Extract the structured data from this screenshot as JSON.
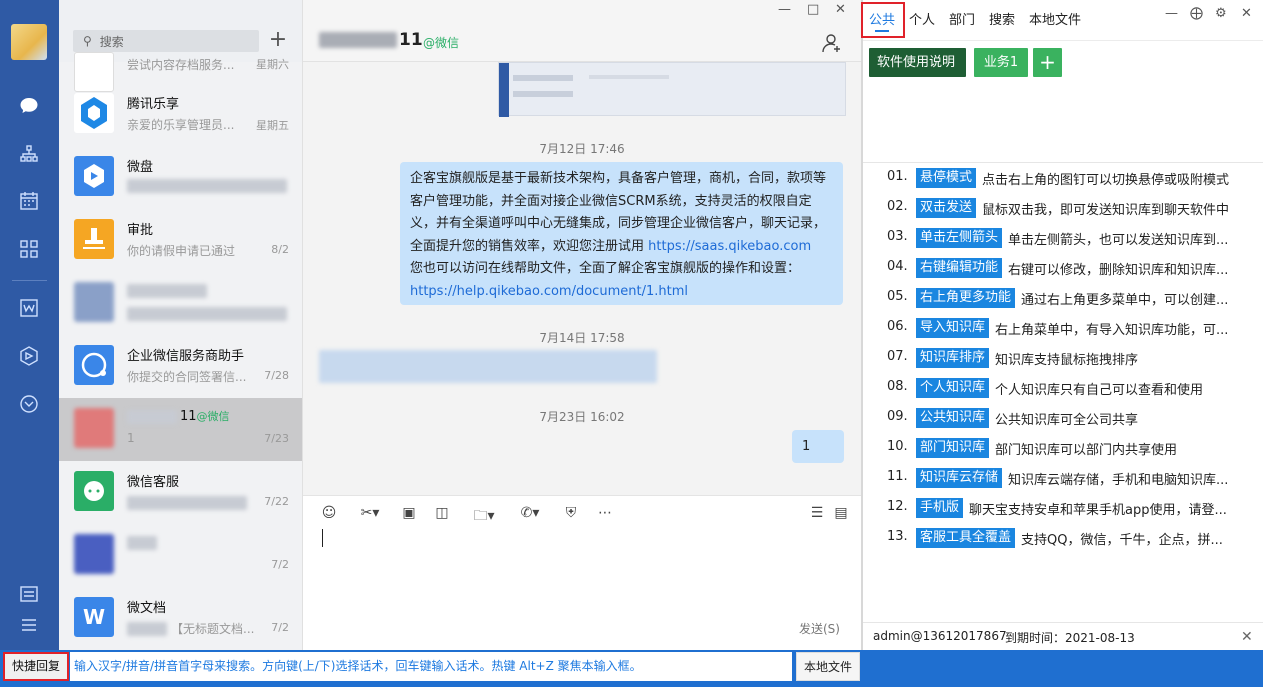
{
  "search": {
    "placeholder": "搜索"
  },
  "conversations": [
    {
      "name": "",
      "snippet": "尝试内容存档服务...",
      "date": "星期六",
      "color": "#f5a623"
    },
    {
      "name": "腾讯乐享",
      "snippet": "亲爱的乐享管理员...",
      "date": "星期五",
      "color": "#1e88e5"
    },
    {
      "name": "微盘",
      "snippet": "",
      "date": "",
      "color": "#3a86e8"
    },
    {
      "name": "审批",
      "snippet": "你的请假申请已通过",
      "date": "8/2",
      "color": "#f5a623"
    },
    {
      "name": "",
      "snippet": "",
      "date": "",
      "color": "#8aa0c8"
    },
    {
      "name": "企业微信服务商助手",
      "snippet": "你提交的合同签署信...",
      "date": "7/28",
      "color": "#3a86e8"
    },
    {
      "name": "11",
      "name_suffix": "@微信",
      "snippet": "1",
      "date": "7/23",
      "color": "#e07a7a"
    },
    {
      "name": "微信客服",
      "snippet": "...企...",
      "date": "7/22",
      "color": "#2aae67"
    },
    {
      "name": "",
      "snippet": "",
      "date": "7/2",
      "color": "#4a5fc1"
    },
    {
      "name": "微文档",
      "snippet": "【无标题文档...",
      "date": "7/2",
      "color": "#3a86e8"
    }
  ],
  "chat": {
    "title": "11",
    "title_suffix": "@微信",
    "timestamps": [
      "7月12日 17:46",
      "7月14日 17:58",
      "7月23日 16:02"
    ],
    "message_main": "企客宝旗舰版是基于最新技术架构，具备客户管理，商机，合同，款项等客户管理功能，并全面对接企业微信SCRM系统，支持灵活的权限自定义，并有全渠道呼叫中心无缝集成，同步管理企业微信客户，聊天记录，全面提升您的销售效率，欢迎您注册试用",
    "message_link1": "https://saas.qikebao.com",
    "message_tail": "您也可以访问在线帮助文件，全面了解企客宝旗舰版的操作和设置：",
    "message_link2": "https://help.qikebao.com/document/1.html",
    "sent_message": "1",
    "send_label": "发送(S)"
  },
  "kb": {
    "tabs": [
      "公共",
      "个人",
      "部门",
      "搜索",
      "本地文件"
    ],
    "active_tab": "公共",
    "buttons": {
      "manual": "软件使用说明",
      "business": "业务1",
      "add": "+"
    },
    "items": [
      {
        "num": "01.",
        "tag": "悬停模式",
        "desc": "点击右上角的图钉可以切换悬停或吸附模式"
      },
      {
        "num": "02.",
        "tag": "双击发送",
        "desc": "鼠标双击我，即可发送知识库到聊天软件中"
      },
      {
        "num": "03.",
        "tag": "单击左侧箭头",
        "desc": "单击左侧箭头，也可以发送知识库到..."
      },
      {
        "num": "04.",
        "tag": "右键编辑功能",
        "desc": "右键可以修改，删除知识库和知识库..."
      },
      {
        "num": "05.",
        "tag": "右上角更多功能",
        "desc": "通过右上角更多菜单中，可以创建..."
      },
      {
        "num": "06.",
        "tag": "导入知识库",
        "desc": "右上角菜单中，有导入知识库功能，可..."
      },
      {
        "num": "07.",
        "tag": "知识库排序",
        "desc": "知识库支持鼠标拖拽排序"
      },
      {
        "num": "08.",
        "tag": "个人知识库",
        "desc": "个人知识库只有自己可以查看和使用"
      },
      {
        "num": "09.",
        "tag": "公共知识库",
        "desc": "公共知识库可全公司共享"
      },
      {
        "num": "10.",
        "tag": "部门知识库",
        "desc": "部门知识库可以部门内共享使用"
      },
      {
        "num": "11.",
        "tag": "知识库云存储",
        "desc": "知识库云端存储，手机和电脑知识库..."
      },
      {
        "num": "12.",
        "tag": "手机版",
        "desc": "聊天宝支持安卓和苹果手机app使用，请登..."
      },
      {
        "num": "13.",
        "tag": "客服工具全覆盖",
        "desc": "支持QQ，微信，千牛，企点，拼..."
      }
    ],
    "footer_user": "admin@13612017867",
    "footer_expire": "到期时间：2021-08-13"
  },
  "bottom": {
    "quick_reply": "快捷回复",
    "hint": "输入汉字/拼音/拼音首字母来搜索。方向键(上/下)选择话术，回车键输入话术。热键 Alt+Z 聚焦本输入框。",
    "local_file": "本地文件"
  },
  "colors": {
    "rail": "#2f5aa5",
    "tag": "#1a86e0",
    "highlight": "#e0222a",
    "bubble": "#c7e2fb"
  }
}
